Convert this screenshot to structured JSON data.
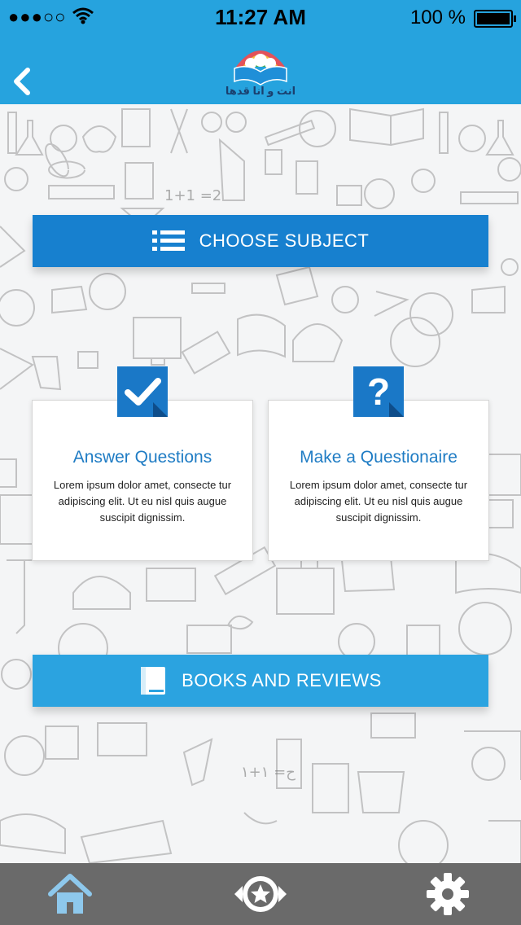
{
  "status_bar": {
    "signal": "●●●○○",
    "time": "11:27 AM",
    "battery": "100 %"
  },
  "header": {
    "logo_text": "انت و انا قدها",
    "back_icon": "chevron-left-icon"
  },
  "buttons": {
    "choose_subject": "CHOOSE SUBJECT",
    "books_and_reviews": "BOOKS AND REVIEWS"
  },
  "cards": [
    {
      "title": "Answer Questions",
      "description": "Lorem ipsum dolor amet, consecte tur adipiscing elit. Ut eu nisl quis augue suscipit dignissim.",
      "icon": "checkmark-icon"
    },
    {
      "title": "Make a Questionaire",
      "description": "Lorem ipsum dolor amet, consecte tur adipiscing elit. Ut eu nisl quis augue suscipit dignissim.",
      "icon": "question-mark-icon",
      "icon_glyph": "?"
    }
  ],
  "tabbar": {
    "items": [
      "home-icon",
      "star-badge-icon",
      "gear-icon"
    ],
    "active_color": "#8ec8ec"
  },
  "colors": {
    "header": "#26a3de",
    "subject_button": "#1780cf",
    "books_button": "#2ba3e0",
    "card_title": "#1f7cc4",
    "tabbar": "#6a6a6a"
  }
}
